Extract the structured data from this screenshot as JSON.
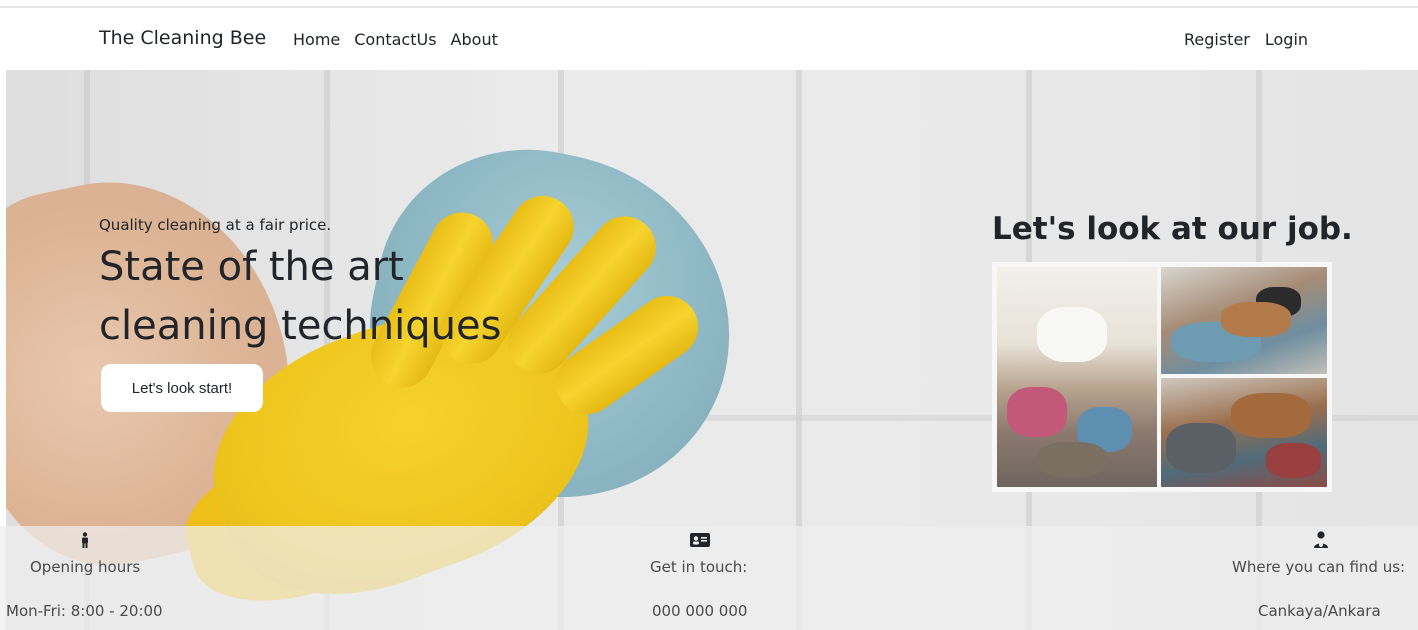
{
  "navbar": {
    "brand": "The Cleaning Bee",
    "links": [
      "Home",
      "ContactUs",
      "About"
    ],
    "right_links": [
      "Register",
      "Login"
    ]
  },
  "hero": {
    "tagline": "Quality cleaning at a fair price.",
    "headline": "State of the art cleaning techniques",
    "cta_label": "Let's look start!"
  },
  "gallery": {
    "title": "Let's look at our job."
  },
  "info": {
    "hours": {
      "icon": "person-standing-icon",
      "label": "Opening hours",
      "value": "Mon-Fri: 8:00 - 20:00"
    },
    "contact": {
      "icon": "contact-card-icon",
      "label": "Get in touch:",
      "value": "000 000 000"
    },
    "location": {
      "icon": "person-location-icon",
      "label": "Where you can find us:",
      "value": "Cankaya/Ankara"
    }
  },
  "colors": {
    "text": "#212529",
    "muted_text": "#4a4a4a",
    "glove": "#f2c81f",
    "cloth": "#8fb9c5"
  }
}
